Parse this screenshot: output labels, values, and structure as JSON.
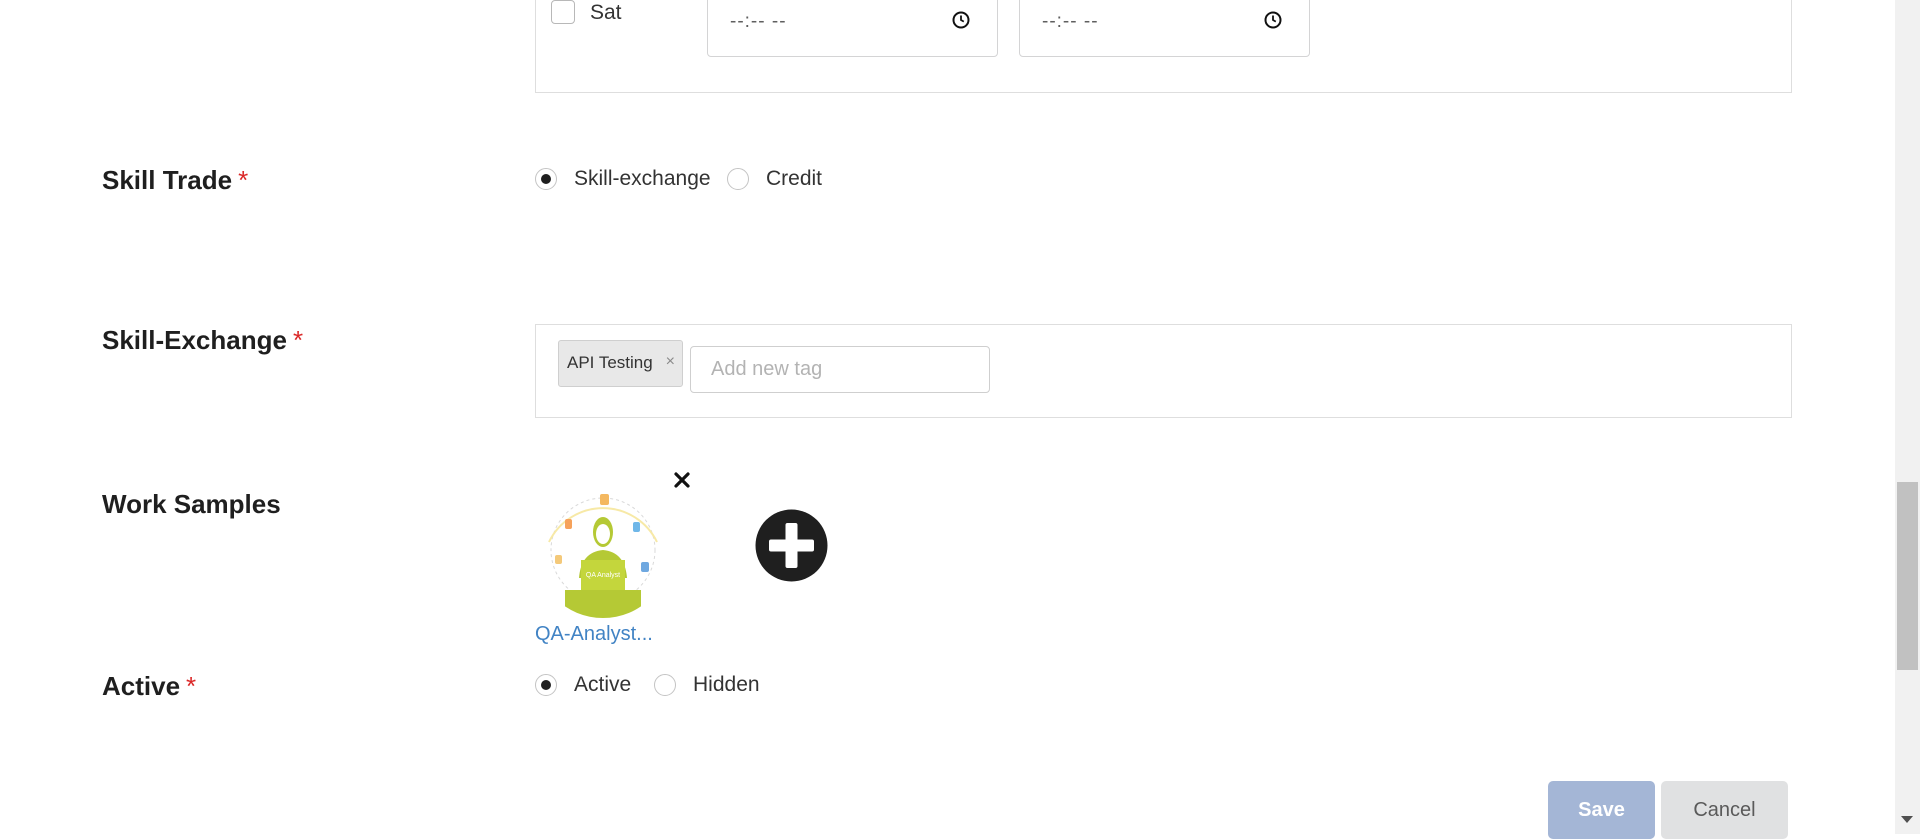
{
  "availability": {
    "day_label": "Sat",
    "start_time": "--:-- --",
    "end_time": "--:-- --"
  },
  "skill_trade": {
    "label": "Skill Trade",
    "required_mark": "*",
    "options": [
      "Skill-exchange",
      "Credit"
    ],
    "selected": "Skill-exchange"
  },
  "skill_exchange": {
    "label": "Skill-Exchange",
    "required_mark": "*",
    "tags": [
      "API Testing"
    ],
    "tag_remove": "×",
    "input_placeholder": "Add new tag"
  },
  "work_samples": {
    "label": "Work Samples",
    "file_name": "QA-Analyst...",
    "thumb_caption": "QA Analyst"
  },
  "active": {
    "label": "Active",
    "required_mark": "*",
    "options": [
      "Active",
      "Hidden"
    ],
    "selected": "Active"
  },
  "buttons": {
    "save": "Save",
    "cancel": "Cancel"
  },
  "colors": {
    "required": "#db2828",
    "link": "#4183c4",
    "save_bg": "#a4b6d6",
    "cancel_bg": "#e0e1e2",
    "thumb_green": "#b5c935"
  }
}
